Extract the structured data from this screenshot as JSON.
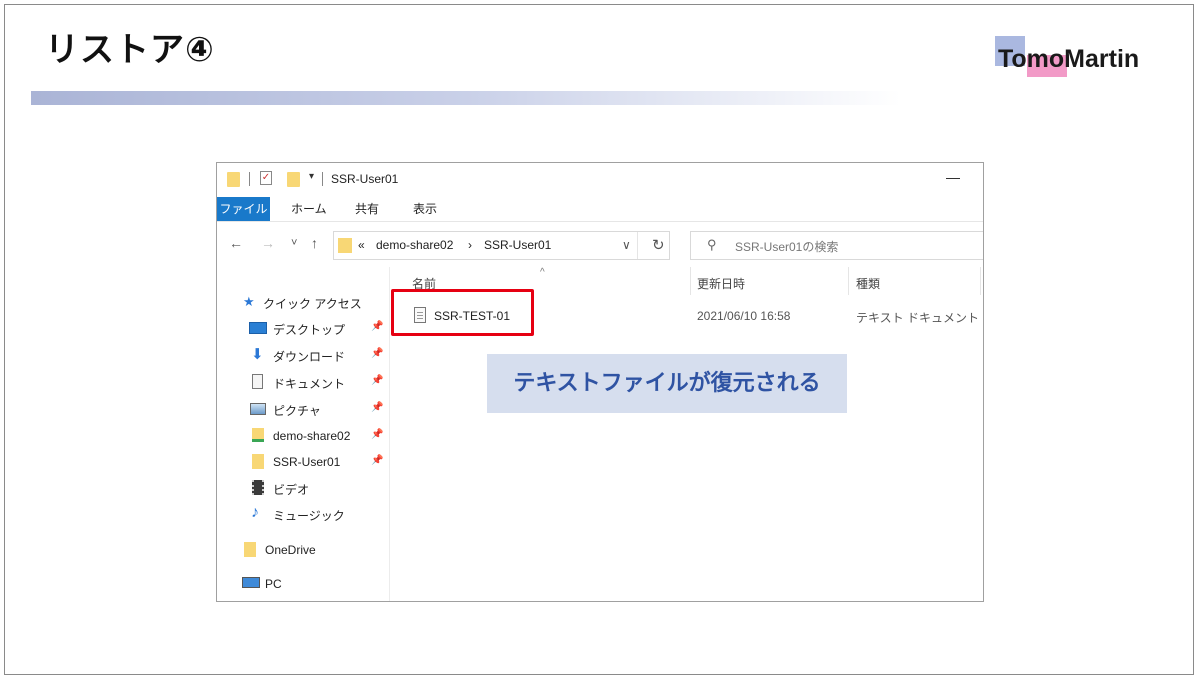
{
  "slide": {
    "title": "リストア④",
    "logo": "TomoMartin"
  },
  "window": {
    "title": "SSR-User01",
    "minimize": "—",
    "ribbon_tabs": [
      "ファイル",
      "ホーム",
      "共有",
      "表示"
    ],
    "nav": {
      "back": "←",
      "forward": "→",
      "recent": "˅",
      "up": "↑"
    },
    "address": {
      "overflow": "«",
      "segments": [
        "demo-share02",
        "SSR-User01"
      ],
      "separator": "›",
      "dropdown": "∨",
      "refresh": "↻"
    },
    "search": {
      "placeholder": "SSR-User01の検索"
    },
    "nav_pane": [
      {
        "label": "クイック アクセス",
        "icon": "star-icon",
        "pinned": false
      },
      {
        "label": "デスクトップ",
        "icon": "desktop-icon",
        "pinned": true
      },
      {
        "label": "ダウンロード",
        "icon": "download-icon",
        "pinned": true
      },
      {
        "label": "ドキュメント",
        "icon": "document-icon",
        "pinned": true
      },
      {
        "label": "ピクチャ",
        "icon": "pictures-icon",
        "pinned": true
      },
      {
        "label": "demo-share02",
        "icon": "network-folder-icon",
        "pinned": true
      },
      {
        "label": "SSR-User01",
        "icon": "folder-icon",
        "pinned": true
      },
      {
        "label": "ビデオ",
        "icon": "video-icon",
        "pinned": false
      },
      {
        "label": "ミュージック",
        "icon": "music-icon",
        "pinned": false
      },
      {
        "label": "OneDrive",
        "icon": "folder-icon",
        "pinned": false
      },
      {
        "label": "PC",
        "icon": "pc-icon",
        "pinned": false
      }
    ],
    "pin_glyph": "📌",
    "columns": [
      "名前",
      "更新日時",
      "種類"
    ],
    "sort_indicator": "^",
    "files": [
      {
        "name": "SSR-TEST-01",
        "modified": "2021/06/10 16:58",
        "type": "テキスト ドキュメント"
      }
    ]
  },
  "callout": "テキストファイルが復元される",
  "colors": {
    "accent_blue": "#1979ca",
    "highlight_red": "#e60012",
    "callout_bg": "#d6deee",
    "callout_text": "#2f53a3"
  }
}
